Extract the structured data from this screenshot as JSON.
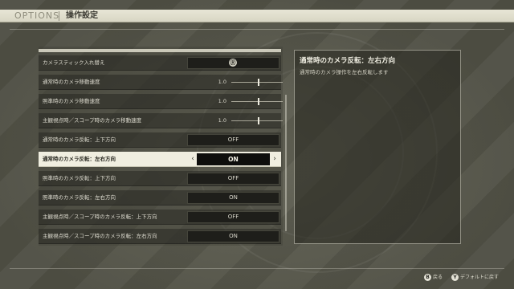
{
  "header": {
    "tab": "OPTIONS",
    "title": "操作設定"
  },
  "settings": [
    {
      "label": "カメラスティック入れ替え",
      "type": "button",
      "icon": "Ⓡ"
    },
    {
      "label": "通常時のカメラ移動速度",
      "type": "slider",
      "value": "1.0",
      "level": 0.4
    },
    {
      "label": "照準時のカメラ移動速度",
      "type": "slider",
      "value": "1.0",
      "level": 0.4
    },
    {
      "label": "主観視点時／スコープ時のカメラ移動速度",
      "type": "slider",
      "value": "1.0",
      "level": 0.4
    },
    {
      "label": "通常時のカメラ反転：上下方向",
      "type": "toggle",
      "value": "OFF"
    },
    {
      "label": "通常時のカメラ反転：左右方向",
      "type": "toggle",
      "value": "ON",
      "selected": true
    },
    {
      "label": "照準時のカメラ反転：上下方向",
      "type": "toggle",
      "value": "OFF"
    },
    {
      "label": "照準時のカメラ反転：左右方向",
      "type": "toggle",
      "value": "ON"
    },
    {
      "label": "主観視点時／スコープ時のカメラ反転：上下方向",
      "type": "toggle",
      "value": "OFF"
    },
    {
      "label": "主観視点時／スコープ時のカメラ反転：左右方向",
      "type": "toggle",
      "value": "ON"
    }
  ],
  "description": {
    "title": "通常時のカメラ反転：左右方向",
    "body": "通常時のカメラ操作を左右反転します"
  },
  "footer": {
    "back_button": "B",
    "back_label": "戻る",
    "default_button": "Y",
    "default_label": "デフォルトに戻す"
  },
  "colors": {
    "background": "#59594c",
    "header": "#e8e6d6",
    "selected_row": "#f0eee0",
    "value_box": "#1e1e1a"
  },
  "icons": {
    "left_arrow": "‹",
    "right_arrow": "›"
  }
}
